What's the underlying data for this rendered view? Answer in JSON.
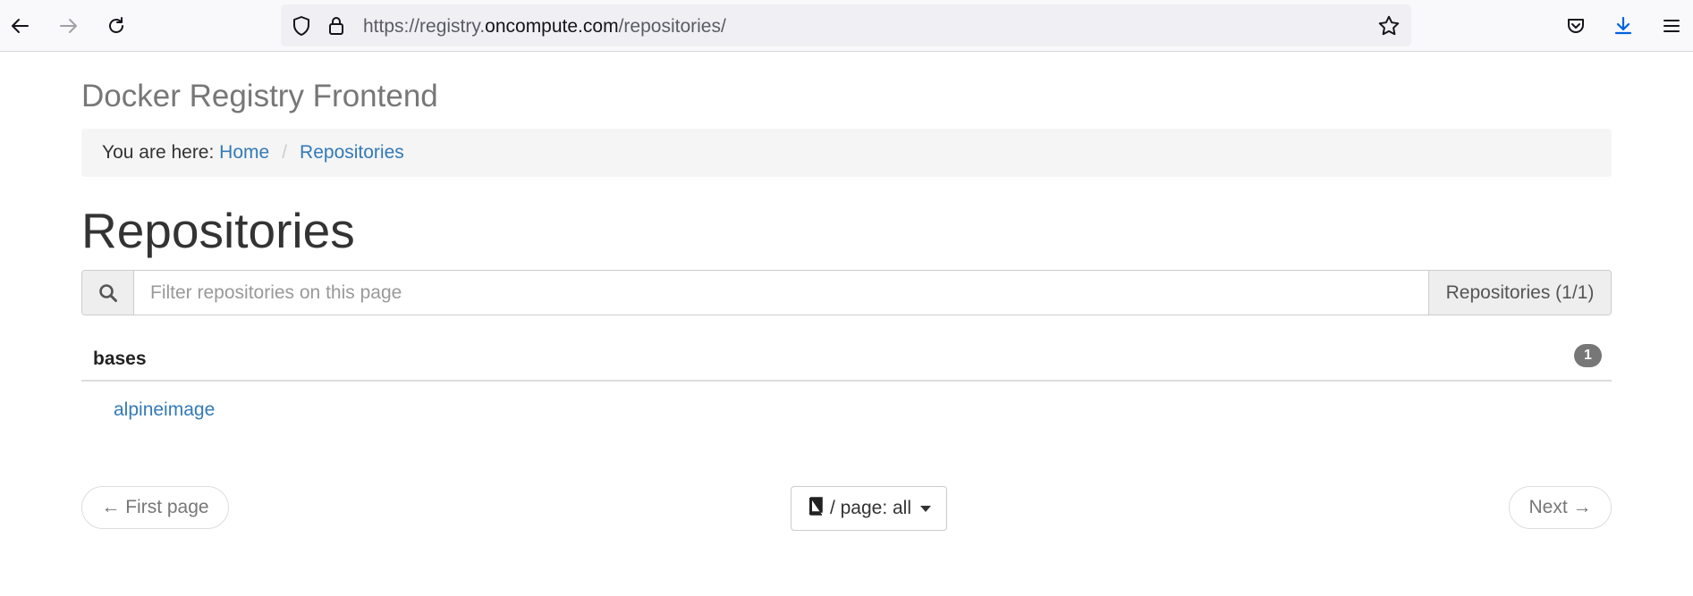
{
  "browser": {
    "url_prefix": "https://registry.",
    "url_host": "oncompute.com",
    "url_path": "/repositories/",
    "icons": [
      "back-icon",
      "forward-icon",
      "reload-icon",
      "shield-icon",
      "lock-icon",
      "star-icon",
      "pocket-icon",
      "download-icon",
      "menu-icon"
    ],
    "download_color": "#0061e0"
  },
  "app": {
    "brand": "Docker Registry Frontend"
  },
  "breadcrumb": {
    "prefix": "You are here:",
    "items": [
      {
        "label": "Home"
      },
      {
        "label": "Repositories"
      }
    ],
    "separator": "/"
  },
  "page": {
    "title": "Repositories"
  },
  "filter": {
    "placeholder": "Filter repositories on this page",
    "count_label": "Repositories (1/1)"
  },
  "groups": [
    {
      "name": "bases",
      "count": "1",
      "repos": [
        {
          "name": "alpineimage"
        }
      ]
    }
  ],
  "pagination": {
    "first_label": "← First page",
    "per_page_label": "/ page: all",
    "next_label": "Next →"
  },
  "colors": {
    "link": "#337ab7",
    "badge": "#777777"
  }
}
